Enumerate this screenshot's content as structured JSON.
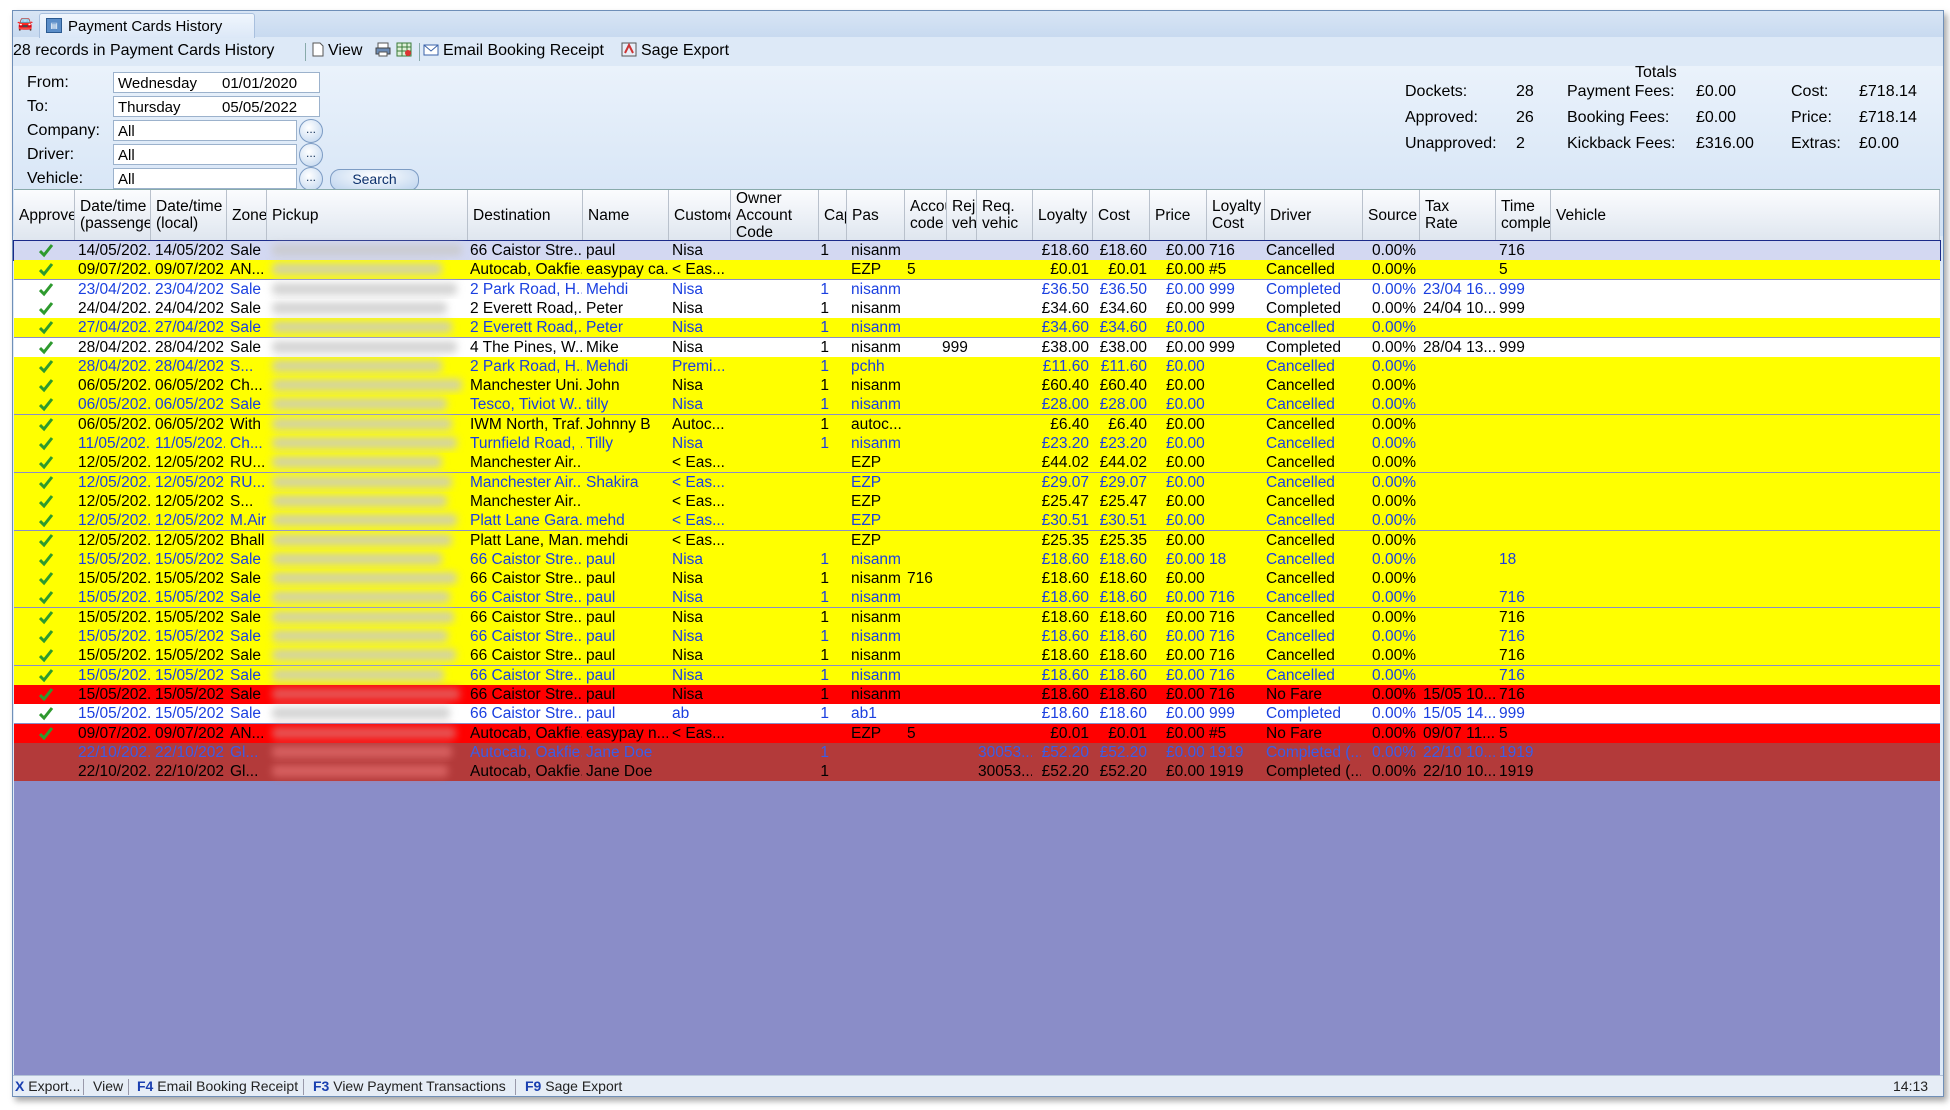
{
  "window": {
    "tab_title": "Payment Cards History"
  },
  "toolbar": {
    "records_text": "28 records in Payment Cards History",
    "view_label": "View",
    "email_label": "Email Booking Receipt",
    "sage_label": "Sage Export"
  },
  "filters": {
    "from_label": "From:",
    "from_day": "Wednesday",
    "from_date": "01/01/2020",
    "to_label": "To:",
    "to_day": "Thursday",
    "to_date": "05/05/2022",
    "company_label": "Company:",
    "company_value": "All",
    "driver_label": "Driver:",
    "driver_value": "All",
    "vehicle_label": "Vehicle:",
    "vehicle_value": "All",
    "ellipsis": "...",
    "search_label": "Search"
  },
  "totals": {
    "title": "Totals",
    "dockets_label": "Dockets:",
    "dockets": "28",
    "approved_label": "Approved:",
    "approved": "26",
    "unapproved_label": "Unapproved:",
    "unapproved": "2",
    "payment_fees_label": "Payment Fees:",
    "payment_fees": "£0.00",
    "booking_fees_label": "Booking Fees:",
    "booking_fees": "£0.00",
    "kickback_fees_label": "Kickback Fees:",
    "kickback_fees": "£316.00",
    "cost_label": "Cost:",
    "cost": "£718.14",
    "price_label": "Price:",
    "price": "£718.14",
    "extras_label": "Extras:",
    "extras": "£0.00"
  },
  "columns": [
    "Approve",
    "Date/time\n(passenger)",
    "Date/time\n(local)",
    "Zone",
    "Pickup",
    "Destination",
    "Name",
    "Customer",
    "Owner\nAccount\nCode",
    "Capa",
    "Pas",
    "Account\ncode",
    "Rej.\nvehic",
    "Req.\nvehic",
    "Loyalty",
    "Cost",
    "Price",
    "Loyalty\nCost",
    "Driver",
    "Source",
    "Tax\nRate",
    "Time\ncompleted",
    "Vehicle"
  ],
  "colors": {
    "selected_row": "#d3d8f2",
    "white_row": "#ffffff",
    "yellow_row": "#ffff00",
    "red_row": "#ff0000",
    "dark_red_row": "#b33a3a",
    "grid_empty": "#8a8dc8",
    "text_blue": "#1a3fe0",
    "text_black": "#000000",
    "check_green": "#2e9a2e"
  },
  "rows": [
    {
      "bg": "selected",
      "tc": "black",
      "chk": true,
      "dp": "14/05/202...",
      "dl": "14/05/202...",
      "zone": "Sale",
      "dest": "66 Caistor Stre...",
      "name": "paul",
      "cust": "Nisa",
      "cap": "1",
      "acct": "nisanm",
      "rej": "",
      "req": "",
      "loy": "",
      "cost": "£18.60",
      "price": "£18.60",
      "lcost": "£0.00",
      "driver": "716",
      "source": "Cancelled",
      "tax": "0.00%",
      "time": "",
      "veh": "716"
    },
    {
      "bg": "yellow",
      "tc": "black",
      "chk": true,
      "dp": "09/07/202...",
      "dl": "09/07/202...",
      "zone": "AN...",
      "dest": "Autocab, Oakfie...",
      "name": "easypay ca...",
      "cust": "< Eas...",
      "cap": "",
      "acct": "EZP",
      "rej": "5",
      "req": "",
      "loy": "",
      "cost": "£0.01",
      "price": "£0.01",
      "lcost": "£0.00",
      "driver": "#5",
      "source": "Cancelled",
      "tax": "0.00%",
      "time": "",
      "veh": "5"
    },
    {
      "bg": "white",
      "tc": "blue",
      "chk": true,
      "dp": "23/04/202...",
      "dl": "23/04/202...",
      "zone": "Sale",
      "dest": "2 Park Road, H...",
      "name": "Mehdi",
      "cust": "Nisa",
      "cap": "1",
      "acct": "nisanm",
      "rej": "",
      "req": "",
      "loy": "",
      "cost": "£36.50",
      "price": "£36.50",
      "lcost": "£0.00",
      "driver": "999",
      "source": "Completed",
      "tax": "0.00%",
      "time": "23/04 16...",
      "veh": "999"
    },
    {
      "bg": "white",
      "tc": "black",
      "chk": true,
      "dp": "24/04/202...",
      "dl": "24/04/202...",
      "zone": "Sale",
      "dest": "2 Everett Road,...",
      "name": "Peter",
      "cust": "Nisa",
      "cap": "1",
      "acct": "nisanm",
      "rej": "",
      "req": "",
      "loy": "",
      "cost": "£34.60",
      "price": "£34.60",
      "lcost": "£0.00",
      "driver": "999",
      "source": "Completed",
      "tax": "0.00%",
      "time": "24/04 10...",
      "veh": "999"
    },
    {
      "bg": "yellow",
      "tc": "blue",
      "chk": true,
      "dp": "27/04/202...",
      "dl": "27/04/202...",
      "zone": "Sale",
      "dest": "2 Everett Road,...",
      "name": "Peter",
      "cust": "Nisa",
      "cap": "1",
      "acct": "nisanm",
      "rej": "",
      "req": "",
      "loy": "",
      "cost": "£34.60",
      "price": "£34.60",
      "lcost": "£0.00",
      "driver": "",
      "source": "Cancelled",
      "tax": "0.00%",
      "time": "",
      "veh": ""
    },
    {
      "bg": "white",
      "tc": "black",
      "chk": true,
      "dp": "28/04/202...",
      "dl": "28/04/202...",
      "zone": "Sale",
      "dest": "4 The Pines, W...",
      "name": "Mike",
      "cust": "Nisa",
      "cap": "1",
      "acct": "nisanm",
      "rej": "",
      "req": "999",
      "loy": "",
      "cost": "£38.00",
      "price": "£38.00",
      "lcost": "£0.00",
      "driver": "999",
      "source": "Completed",
      "tax": "0.00%",
      "time": "28/04 13...",
      "veh": "999"
    },
    {
      "bg": "yellow",
      "tc": "blue",
      "chk": true,
      "dp": "28/04/202...",
      "dl": "28/04/202...",
      "zone": "S...",
      "dest": "2 Park Road, H...",
      "name": "Mehdi",
      "cust": "Premi...",
      "cap": "1",
      "acct": "pchh",
      "rej": "",
      "req": "",
      "loy": "",
      "cost": "£11.60",
      "price": "£11.60",
      "lcost": "£0.00",
      "driver": "",
      "source": "Cancelled",
      "tax": "0.00%",
      "time": "",
      "veh": ""
    },
    {
      "bg": "yellow",
      "tc": "black",
      "chk": true,
      "dp": "06/05/202...",
      "dl": "06/05/202...",
      "zone": "Ch...",
      "dest": "Manchester Uni...",
      "name": "John",
      "cust": "Nisa",
      "cap": "1",
      "acct": "nisanm",
      "rej": "",
      "req": "",
      "loy": "",
      "cost": "£60.40",
      "price": "£60.40",
      "lcost": "£0.00",
      "driver": "",
      "source": "Cancelled",
      "tax": "0.00%",
      "time": "",
      "veh": ""
    },
    {
      "bg": "yellow",
      "tc": "blue",
      "chk": true,
      "dp": "06/05/202...",
      "dl": "06/05/202...",
      "zone": "Sale",
      "dest": "Tesco, Tiviot W...",
      "name": "tilly",
      "cust": "Nisa",
      "cap": "1",
      "acct": "nisanm",
      "rej": "",
      "req": "",
      "loy": "",
      "cost": "£28.00",
      "price": "£28.00",
      "lcost": "£0.00",
      "driver": "",
      "source": "Cancelled",
      "tax": "0.00%",
      "time": "",
      "veh": ""
    },
    {
      "bg": "yellow",
      "tc": "black",
      "chk": true,
      "dp": "06/05/202...",
      "dl": "06/05/202...",
      "zone": "With",
      "dest": "IWM North, Traf...",
      "name": "Johnny B",
      "cust": "Autoc...",
      "cap": "1",
      "acct": "autoc...",
      "rej": "",
      "req": "",
      "loy": "",
      "cost": "£6.40",
      "price": "£6.40",
      "lcost": "£0.00",
      "driver": "",
      "source": "Cancelled",
      "tax": "0.00%",
      "time": "",
      "veh": ""
    },
    {
      "bg": "yellow",
      "tc": "blue",
      "chk": true,
      "dp": "11/05/202...",
      "dl": "11/05/202...",
      "zone": "Ch...",
      "dest": "Turnfield Road, ...",
      "name": "Tilly",
      "cust": "Nisa",
      "cap": "1",
      "acct": "nisanm",
      "rej": "",
      "req": "",
      "loy": "",
      "cost": "£23.20",
      "price": "£23.20",
      "lcost": "£0.00",
      "driver": "",
      "source": "Cancelled",
      "tax": "0.00%",
      "time": "",
      "veh": ""
    },
    {
      "bg": "yellow",
      "tc": "black",
      "chk": true,
      "dp": "12/05/202...",
      "dl": "12/05/202...",
      "zone": "RU...",
      "dest": "Manchester Air...",
      "name": "",
      "cust": "< Eas...",
      "cap": "",
      "acct": "EZP",
      "rej": "",
      "req": "",
      "loy": "",
      "cost": "£44.02",
      "price": "£44.02",
      "lcost": "£0.00",
      "driver": "",
      "source": "Cancelled",
      "tax": "0.00%",
      "time": "",
      "veh": ""
    },
    {
      "bg": "yellow",
      "tc": "blue",
      "chk": true,
      "dp": "12/05/202...",
      "dl": "12/05/202...",
      "zone": "RU...",
      "dest": "Manchester Air...",
      "name": "Shakira",
      "cust": "< Eas...",
      "cap": "",
      "acct": "EZP",
      "rej": "",
      "req": "",
      "loy": "",
      "cost": "£29.07",
      "price": "£29.07",
      "lcost": "£0.00",
      "driver": "",
      "source": "Cancelled",
      "tax": "0.00%",
      "time": "",
      "veh": ""
    },
    {
      "bg": "yellow",
      "tc": "black",
      "chk": true,
      "dp": "12/05/202...",
      "dl": "12/05/202...",
      "zone": "S...",
      "dest": "Manchester Air...",
      "name": "",
      "cust": "< Eas...",
      "cap": "",
      "acct": "EZP",
      "rej": "",
      "req": "",
      "loy": "",
      "cost": "£25.47",
      "price": "£25.47",
      "lcost": "£0.00",
      "driver": "",
      "source": "Cancelled",
      "tax": "0.00%",
      "time": "",
      "veh": ""
    },
    {
      "bg": "yellow",
      "tc": "blue",
      "chk": true,
      "dp": "12/05/202...",
      "dl": "12/05/202...",
      "zone": "M.Air",
      "dest": "Platt Lane Gara...",
      "name": "mehd",
      "cust": "< Eas...",
      "cap": "",
      "acct": "EZP",
      "rej": "",
      "req": "",
      "loy": "",
      "cost": "£30.51",
      "price": "£30.51",
      "lcost": "£0.00",
      "driver": "",
      "source": "Cancelled",
      "tax": "0.00%",
      "time": "",
      "veh": ""
    },
    {
      "bg": "yellow",
      "tc": "black",
      "chk": true,
      "dp": "12/05/202...",
      "dl": "12/05/202...",
      "zone": "Bhall",
      "dest": "Platt Lane, Man...",
      "name": "mehdi",
      "cust": "< Eas...",
      "cap": "",
      "acct": "EZP",
      "rej": "",
      "req": "",
      "loy": "",
      "cost": "£25.35",
      "price": "£25.35",
      "lcost": "£0.00",
      "driver": "",
      "source": "Cancelled",
      "tax": "0.00%",
      "time": "",
      "veh": ""
    },
    {
      "bg": "yellow",
      "tc": "blue",
      "chk": true,
      "dp": "15/05/202...",
      "dl": "15/05/202...",
      "zone": "Sale",
      "dest": "66 Caistor Stre...",
      "name": "paul",
      "cust": "Nisa",
      "cap": "1",
      "acct": "nisanm",
      "rej": "",
      "req": "",
      "loy": "",
      "cost": "£18.60",
      "price": "£18.60",
      "lcost": "£0.00",
      "driver": "18",
      "source": "Cancelled",
      "tax": "0.00%",
      "time": "",
      "veh": "18"
    },
    {
      "bg": "yellow",
      "tc": "black",
      "chk": true,
      "dp": "15/05/202...",
      "dl": "15/05/202...",
      "zone": "Sale",
      "dest": "66 Caistor Stre...",
      "name": "paul",
      "cust": "Nisa",
      "cap": "1",
      "acct": "nisanm",
      "rej": "716",
      "req": "",
      "loy": "",
      "cost": "£18.60",
      "price": "£18.60",
      "lcost": "£0.00",
      "driver": "",
      "source": "Cancelled",
      "tax": "0.00%",
      "time": "",
      "veh": ""
    },
    {
      "bg": "yellow",
      "tc": "blue",
      "chk": true,
      "dp": "15/05/202...",
      "dl": "15/05/202...",
      "zone": "Sale",
      "dest": "66 Caistor Stre...",
      "name": "paul",
      "cust": "Nisa",
      "cap": "1",
      "acct": "nisanm",
      "rej": "",
      "req": "",
      "loy": "",
      "cost": "£18.60",
      "price": "£18.60",
      "lcost": "£0.00",
      "driver": "716",
      "source": "Cancelled",
      "tax": "0.00%",
      "time": "",
      "veh": "716"
    },
    {
      "bg": "yellow",
      "tc": "black",
      "chk": true,
      "dp": "15/05/202...",
      "dl": "15/05/202...",
      "zone": "Sale",
      "dest": "66 Caistor Stre...",
      "name": "paul",
      "cust": "Nisa",
      "cap": "1",
      "acct": "nisanm",
      "rej": "",
      "req": "",
      "loy": "",
      "cost": "£18.60",
      "price": "£18.60",
      "lcost": "£0.00",
      "driver": "716",
      "source": "Cancelled",
      "tax": "0.00%",
      "time": "",
      "veh": "716"
    },
    {
      "bg": "yellow",
      "tc": "blue",
      "chk": true,
      "dp": "15/05/202...",
      "dl": "15/05/202...",
      "zone": "Sale",
      "dest": "66 Caistor Stre...",
      "name": "paul",
      "cust": "Nisa",
      "cap": "1",
      "acct": "nisanm",
      "rej": "",
      "req": "",
      "loy": "",
      "cost": "£18.60",
      "price": "£18.60",
      "lcost": "£0.00",
      "driver": "716",
      "source": "Cancelled",
      "tax": "0.00%",
      "time": "",
      "veh": "716"
    },
    {
      "bg": "yellow",
      "tc": "black",
      "chk": true,
      "dp": "15/05/202...",
      "dl": "15/05/202...",
      "zone": "Sale",
      "dest": "66 Caistor Stre...",
      "name": "paul",
      "cust": "Nisa",
      "cap": "1",
      "acct": "nisanm",
      "rej": "",
      "req": "",
      "loy": "",
      "cost": "£18.60",
      "price": "£18.60",
      "lcost": "£0.00",
      "driver": "716",
      "source": "Cancelled",
      "tax": "0.00%",
      "time": "",
      "veh": "716"
    },
    {
      "bg": "yellow",
      "tc": "blue",
      "chk": true,
      "dp": "15/05/202...",
      "dl": "15/05/202...",
      "zone": "Sale",
      "dest": "66 Caistor Stre...",
      "name": "paul",
      "cust": "Nisa",
      "cap": "1",
      "acct": "nisanm",
      "rej": "",
      "req": "",
      "loy": "",
      "cost": "£18.60",
      "price": "£18.60",
      "lcost": "£0.00",
      "driver": "716",
      "source": "Cancelled",
      "tax": "0.00%",
      "time": "",
      "veh": "716"
    },
    {
      "bg": "red",
      "tc": "black",
      "chk": true,
      "dp": "15/05/202...",
      "dl": "15/05/202...",
      "zone": "Sale",
      "dest": "66 Caistor Stre...",
      "name": "paul",
      "cust": "Nisa",
      "cap": "1",
      "acct": "nisanm",
      "rej": "",
      "req": "",
      "loy": "",
      "cost": "£18.60",
      "price": "£18.60",
      "lcost": "£0.00",
      "driver": "716",
      "source": "No Fare",
      "tax": "0.00%",
      "time": "15/05 10...",
      "veh": "716"
    },
    {
      "bg": "white",
      "tc": "blue",
      "chk": true,
      "dp": "15/05/202...",
      "dl": "15/05/202...",
      "zone": "Sale",
      "dest": "66 Caistor Stre...",
      "name": "paul",
      "cust": "ab",
      "cap": "1",
      "acct": "ab1",
      "rej": "",
      "req": "",
      "loy": "",
      "cost": "£18.60",
      "price": "£18.60",
      "lcost": "£0.00",
      "driver": "999",
      "source": "Completed",
      "tax": "0.00%",
      "time": "15/05 14...",
      "veh": "999"
    },
    {
      "bg": "red",
      "tc": "black",
      "chk": true,
      "dp": "09/07/202...",
      "dl": "09/07/202...",
      "zone": "AN...",
      "dest": "Autocab, Oakfie...",
      "name": "easypay n...",
      "cust": "< Eas...",
      "cap": "",
      "acct": "EZP",
      "rej": "5",
      "req": "",
      "loy": "",
      "cost": "£0.01",
      "price": "£0.01",
      "lcost": "£0.00",
      "driver": "#5",
      "source": "No Fare",
      "tax": "0.00%",
      "time": "09/07 11...",
      "veh": "5"
    },
    {
      "bg": "darkred",
      "tc": "faded",
      "chk": false,
      "dp": "22/10/202...",
      "dl": "22/10/202...",
      "zone": "Gl...",
      "dest": "Autocab, Oakfie...",
      "name": "Jane Doe",
      "cust": "",
      "cap": "1",
      "acct": "",
      "rej": "",
      "req": "",
      "loy": "30053...",
      "cost": "£52.20",
      "price": "£52.20",
      "lcost": "£0.00",
      "driver": "1919",
      "source": "Completed (...",
      "tax": "0.00%",
      "time": "22/10 10...",
      "veh": "1919"
    },
    {
      "bg": "darkred",
      "tc": "black",
      "chk": false,
      "dp": "22/10/202...",
      "dl": "22/10/202...",
      "zone": "Gl...",
      "dest": "Autocab, Oakfie...",
      "name": "Jane Doe",
      "cust": "",
      "cap": "1",
      "acct": "",
      "rej": "",
      "req": "",
      "loy": "30053...",
      "cost": "£52.20",
      "price": "£52.20",
      "lcost": "£0.00",
      "driver": "1919",
      "source": "Completed (...",
      "tax": "0.00%",
      "time": "22/10 10...",
      "veh": "1919"
    }
  ],
  "statusbar": {
    "x_key": "X",
    "export_label": "Export...",
    "view_label": "View",
    "f4_key": "F4",
    "f4_label": "Email Booking Receipt",
    "f3_key": "F3",
    "f3_label": "View Payment Transactions",
    "f9_key": "F9",
    "f9_label": "Sage Export",
    "clock": "14:13"
  }
}
